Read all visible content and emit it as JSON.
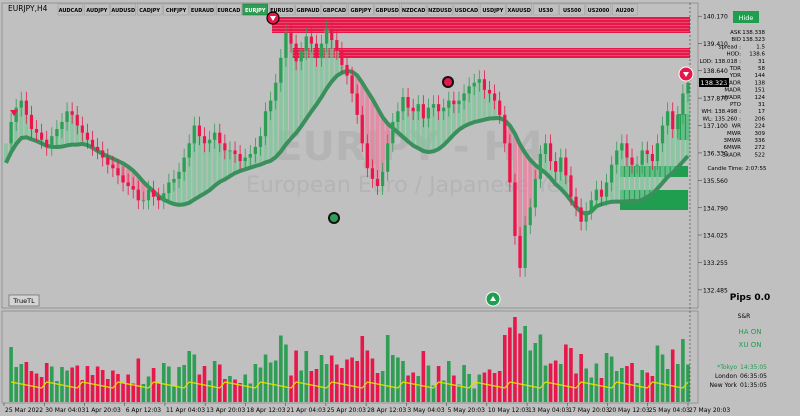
{
  "window_title": "EURJPY,H4",
  "symbol_tabs": [
    "AUDCAD",
    "AUDJPY",
    "AUDUSD",
    "CADJPY",
    "CHFJPY",
    "EURAUD",
    "EURCAD",
    "EURJPY",
    "EURUSD",
    "GBPAUD",
    "GBPCAD",
    "GBPJPY",
    "GBPUSD",
    "NZDCAD",
    "NZDUSD",
    "USDCAD",
    "USDJPY",
    "XAUUSD",
    "US30",
    "US500",
    "US2000",
    "AU200"
  ],
  "active_tab": "EURJPY",
  "watermark": {
    "title": "EURJPY - H4",
    "subtitle": "European Euro / Japanese Yen"
  },
  "hide_button": "Hide",
  "stats": [
    {
      "label": "ASK",
      "value": "138.338"
    },
    {
      "label": "BID",
      "value": "138.323"
    },
    {
      "label": "spread :",
      "value": "1.5"
    },
    {
      "label": "HOD:",
      "value": "138.6"
    },
    {
      "label": "LOD: 138.018 :",
      "value": "31"
    },
    {
      "label": "TDR",
      "value": "58"
    },
    {
      "label": "YDR",
      "value": "144"
    },
    {
      "label": "WADR",
      "value": "138"
    },
    {
      "label": "MADR",
      "value": "151"
    },
    {
      "label": "HYADR",
      "value": "124"
    },
    {
      "label": "PTO",
      "value": "31"
    },
    {
      "label": "WH: 138.498 :",
      "value": "17"
    },
    {
      "label": "WL: 135.260 :",
      "value": "206"
    },
    {
      "label": "WR",
      "value": "224"
    },
    {
      "label": "MWR",
      "value": "309"
    },
    {
      "label": "3MWR",
      "value": "336"
    },
    {
      "label": "6MWR",
      "value": "272"
    },
    {
      "label": "3xADR",
      "value": "522"
    }
  ],
  "candle_time": "Candle Time: 2:07:55",
  "trueTL_button": "TrueTL",
  "pips": "Pips 0.0",
  "current_price": "138.323",
  "price_ticks": [
    "140.170",
    "139.410",
    "138.640",
    "137.870",
    "137.100",
    "136.330",
    "135.560",
    "134.790",
    "134.025",
    "133.255",
    "132.485"
  ],
  "date_ticks": [
    "25 Mar 2022",
    "30 Mar 04:03",
    "1 Apr 20:03",
    "6 Apr 12:03",
    "11 Apr 04:03",
    "13 Apr 20:03",
    "18 Apr 12:03",
    "21 Apr 04:03",
    "25 Apr 20:03",
    "28 Apr 12:03",
    "3 May 04:03",
    "5 May 20:03",
    "10 May 12:03",
    "13 May 04:03",
    "17 May 20:03",
    "20 May 12:03",
    "25 May 04:03",
    "27 May 20:03"
  ],
  "sr_panel": {
    "title": "S&R",
    "ha": "HA ON",
    "xu": "XU ON"
  },
  "sessions": [
    {
      "name": "*Tokyo",
      "time": "14:35:05"
    },
    {
      "name": "London",
      "time": "06:35:05"
    },
    {
      "name": "New York",
      "time": "01:35:05"
    }
  ],
  "colors": {
    "bull": "#2e9e55",
    "bear": "#e8174a",
    "ma": "#3a8f5c",
    "zone": "#e8174a",
    "zone_green": "#1e9e4e",
    "bg": "#c0c0c0",
    "vol_line": "#e0e000"
  },
  "chart_data": {
    "type": "candlestick",
    "title": "EURJPY,H4",
    "ylim": [
      132.2,
      140.4
    ],
    "close_series": [
      136.6,
      137.2,
      137.6,
      137.8,
      137.4,
      137.0,
      136.9,
      136.7,
      136.5,
      136.8,
      137.0,
      137.2,
      137.5,
      137.4,
      137.1,
      136.9,
      136.7,
      136.5,
      136.4,
      136.2,
      136.0,
      135.9,
      135.7,
      135.5,
      135.4,
      135.3,
      135.0,
      135.0,
      135.3,
      135.1,
      135.0,
      135.2,
      135.5,
      135.6,
      135.8,
      136.2,
      136.6,
      137.1,
      136.8,
      136.6,
      136.7,
      136.9,
      136.6,
      136.4,
      136.4,
      136.3,
      136.1,
      136.2,
      136.3,
      136.5,
      136.8,
      137.5,
      137.8,
      138.3,
      139.0,
      139.7,
      139.4,
      138.9,
      139.2,
      139.6,
      139.4,
      139.0,
      139.4,
      139.8,
      139.5,
      139.2,
      138.8,
      138.5,
      138.0,
      137.4,
      136.6,
      135.9,
      135.6,
      135.4,
      135.8,
      136.6,
      137.2,
      137.5,
      137.9,
      137.6,
      137.5,
      137.7,
      137.3,
      137.6,
      137.7,
      137.5,
      137.6,
      137.8,
      137.7,
      137.8,
      138.0,
      138.2,
      138.3,
      138.4,
      138.1,
      138.0,
      137.8,
      137.4,
      136.6,
      135.5,
      134.0,
      133.1,
      134.3,
      134.8,
      135.6,
      136.3,
      136.6,
      136.1,
      135.8,
      136.2,
      135.7,
      135.1,
      134.8,
      134.4,
      134.7,
      135.0,
      135.3,
      135.1,
      135.5,
      136.0,
      136.4,
      136.6,
      136.2,
      136.0,
      136.0,
      136.4,
      136.3,
      136.1,
      136.6,
      137.1,
      137.5,
      137.0,
      137.4,
      138.0,
      138.3
    ]
  }
}
